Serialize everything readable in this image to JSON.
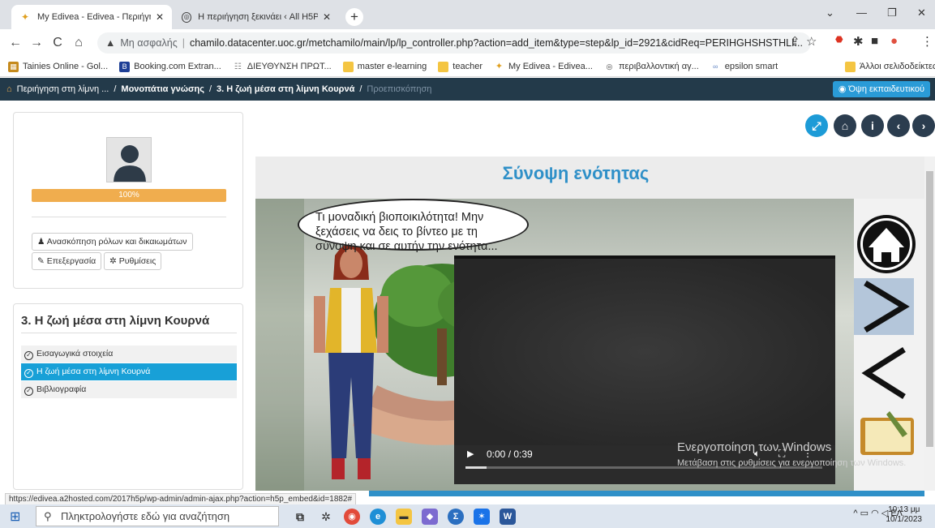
{
  "browser": {
    "tabs": [
      {
        "title": "My Edivea - Edivea - Περιήγηση",
        "active": true
      },
      {
        "title": "Η περιήγηση ξεκινάει ‹ All H5P C",
        "active": false
      }
    ],
    "url_prefix": "Μη ασφαλής",
    "url": "chamilo.datacenter.uoc.gr/metchamilo/main/lp/lp_controller.php?action=add_item&type=step&lp_id=2921&cidReq=PERIHGHSHSTHLI...",
    "bookmarks": [
      "Tainies Online - Gol...",
      "Booking.com Extran...",
      "ΔΙΕΥΘΥΝΣΗ ΠΡΩΤ...",
      "master e-learning",
      "teacher",
      "My Edivea - Edivea...",
      "περιβαλλοντική αγ...",
      "epsilon smart"
    ],
    "other_bookmarks": "Άλλοι σελιδοδείκτες"
  },
  "lms": {
    "breadcrumb": [
      "Περιήγηση στη λίμνη ...",
      "Μονοπάτια γνώσης",
      "3. Η ζωή μέσα στη λίμνη Κουρνά",
      "Προεπισκόπηση"
    ],
    "teacher_view": "Όψη εκπαιδευτικού",
    "progress_label": "100%",
    "progress_value": 1.0,
    "roles_button": "Ανασκόπηση ρόλων και δικαιωμάτων",
    "edit_button": "Επεξεργασία",
    "settings_button": "Ρυθμίσεις",
    "lp_title": "3. Η ζωή μέσα στη λίμνη Κουρνά",
    "lp_items": [
      {
        "label": "Εισαγωγικά στοιχεία",
        "active": false
      },
      {
        "label": "Η ζωή μέσα στη λίμνη Κουρνά",
        "active": true
      },
      {
        "label": "Βιβλιογραφία",
        "active": false
      }
    ]
  },
  "content": {
    "title": "Σύνοψη ενότητας",
    "bubble": "Τι μοναδική βιοποικιλότητα! Μην ξεχάσεις να δεις το βίντεο με τη σύνοψη και σε αυτήν την ενότητα...",
    "video_time": "0:00 / 0:39",
    "video_progress": 0.06,
    "watermark": "Ενεργοποίηση των Windows",
    "watermark_sub": "Μετάβαση στις ρυθμίσεις για ενεργοποίηση των Windows."
  },
  "status_url": "https://edivea.a2hosted.com/2017h5p/wp-admin/admin-ajax.php?action=h5p_embed&id=1882#",
  "taskbar": {
    "search_placeholder": "Πληκτρολογήστε εδώ για αναζήτηση",
    "lang": "ΕΛ",
    "time": "10:13 μμ",
    "date": "10/1/2023"
  },
  "colors": {
    "accent": "#2f90c8",
    "progress": "#f0ad4e",
    "lms_bar": "#233a4a",
    "active_item": "#18a0d7"
  }
}
